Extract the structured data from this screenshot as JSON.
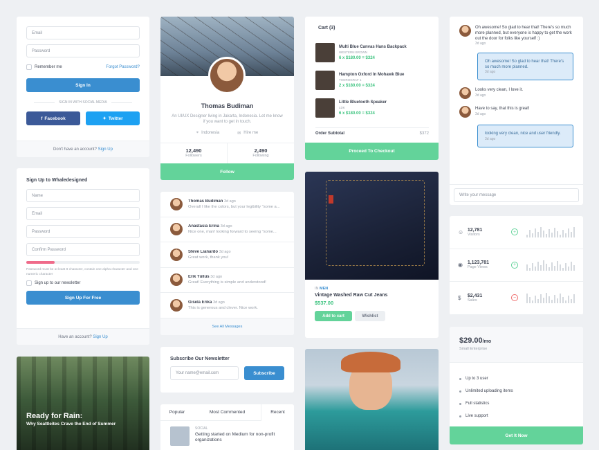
{
  "signin": {
    "email_ph": "Email",
    "password_ph": "Password",
    "remember": "Remember me",
    "forgot": "Forgot Password?",
    "signin_btn": "Sign In",
    "social_divider": "SIGN IN WITH SOCIAL MEDIA",
    "facebook": "Facebook",
    "twitter": "Twitter",
    "no_account": "Don't have an account?",
    "signup_link": "Sign Up"
  },
  "signup": {
    "title": "Sign Up to Whaledesigned",
    "name_ph": "Name",
    "email_ph": "Email",
    "password_ph": "Password",
    "confirm_ph": "Confirm Password",
    "hint": "Password must be at least 8 character, contain one alpha character and one numeric character",
    "newsletter": "Sign up to our newsletter",
    "btn": "Sign Up For Free",
    "have_account": "Have an account?",
    "signup_link": "Sign Up"
  },
  "blog": {
    "title": "Ready for Rain:",
    "subtitle": "Why Seattleites Crave the End of Summer"
  },
  "profile": {
    "name": "Thomas Budiman",
    "bio": "An UI/UX Designer living in Jakarta, Indonesia. Let me know if you want to get in touch.",
    "location": "Indonesia",
    "hire": "Hire me",
    "followers": "12,490",
    "followers_label": "Followers",
    "following": "2,490",
    "following_label": "Following",
    "follow_btn": "Follow"
  },
  "comments": {
    "items": [
      {
        "name": "Thomas Budiman",
        "time": "3d ago",
        "text": "Overall I like the colors, but your legibility \"some a..."
      },
      {
        "name": "Anastasia Erina",
        "time": "3d ago",
        "text": "Nice one, man! looking forward to seeing \"some..."
      },
      {
        "name": "Steve Lianardo",
        "time": "3d ago",
        "text": "Great work, thank you!"
      },
      {
        "name": "Erik Yullus",
        "time": "3d ago",
        "text": "Great! Everything is simple and understood!"
      },
      {
        "name": "Gisela Erika",
        "time": "3d ago",
        "text": "This is generous and clever. Nice work."
      }
    ],
    "see_all": "See All Messages"
  },
  "newsletter": {
    "title": "Subscribe Our Newsletter",
    "placeholder": "Your name@email.com",
    "btn": "Subscribe"
  },
  "tabs": {
    "items": [
      "Popular",
      "Most Commented",
      "Recent"
    ],
    "tag": "SOCIAL",
    "post": "Getting started on Medium for non-profit organizations"
  },
  "cart": {
    "title": "Cart (3)",
    "items": [
      {
        "name": "Multi Blue Canvas Hans Backpack",
        "brand": "WESTERN BROWN",
        "price": "6 x $180.00 = $324"
      },
      {
        "name": "Hampton Oxford In Mohawk Blue",
        "brand": "THOROGRAF 1",
        "price": "2 x $180.00 = $324"
      },
      {
        "name": "Little Bluetooth Speaker",
        "brand": "LDK",
        "price": "6 x $180.00 = $324"
      }
    ],
    "subtotal_label": "Order Subtotal",
    "subtotal": "$372",
    "checkout": "Proceed To Checkout"
  },
  "product": {
    "prefix": "IN",
    "category": "MEN",
    "name": "Vintage Washed Raw Cut Jeans",
    "price": "$537.00",
    "add": "Add to cart",
    "wishlist": "Wishlist"
  },
  "chat": {
    "messages": [
      {
        "text": "Oh awesome! So glad to hear that! There's so much more planned, but everyone is happy to get the work out the door for folks like yourself :)",
        "time": "3d ago"
      },
      {
        "text": "Oh awesome! So glad to hear that! There's so much more planned.",
        "time": "3d ago"
      },
      {
        "text": "Looks very clean, I love it.",
        "time": "3d ago"
      },
      {
        "text": "Have to say, that this is great!",
        "time": "3d ago"
      },
      {
        "text": "looking very clean, nice and user friendly.",
        "time": "3d ago"
      }
    ],
    "placeholder": "Write your message"
  },
  "stats": [
    {
      "value": "12,781",
      "label": "Visitors",
      "icon": "smile-icon",
      "status": "up"
    },
    {
      "value": "1,123,781",
      "label": "Page Views",
      "icon": "eye-icon",
      "status": "up"
    },
    {
      "value": "$2,431",
      "label": "Sales",
      "icon": "money-icon",
      "status": "down"
    }
  ],
  "pricing": {
    "price": "$29.00",
    "per": "/mo",
    "plan": "Small Enterprise",
    "features": [
      "Up to 3 user",
      "Unlimited uploading items",
      "Full statistics",
      "Live support"
    ],
    "btn": "Get It Now"
  },
  "colors": {
    "accent_blue": "#3a8ed0",
    "accent_green": "#63d39a",
    "facebook": "#3b5998",
    "twitter": "#1da1f2"
  }
}
